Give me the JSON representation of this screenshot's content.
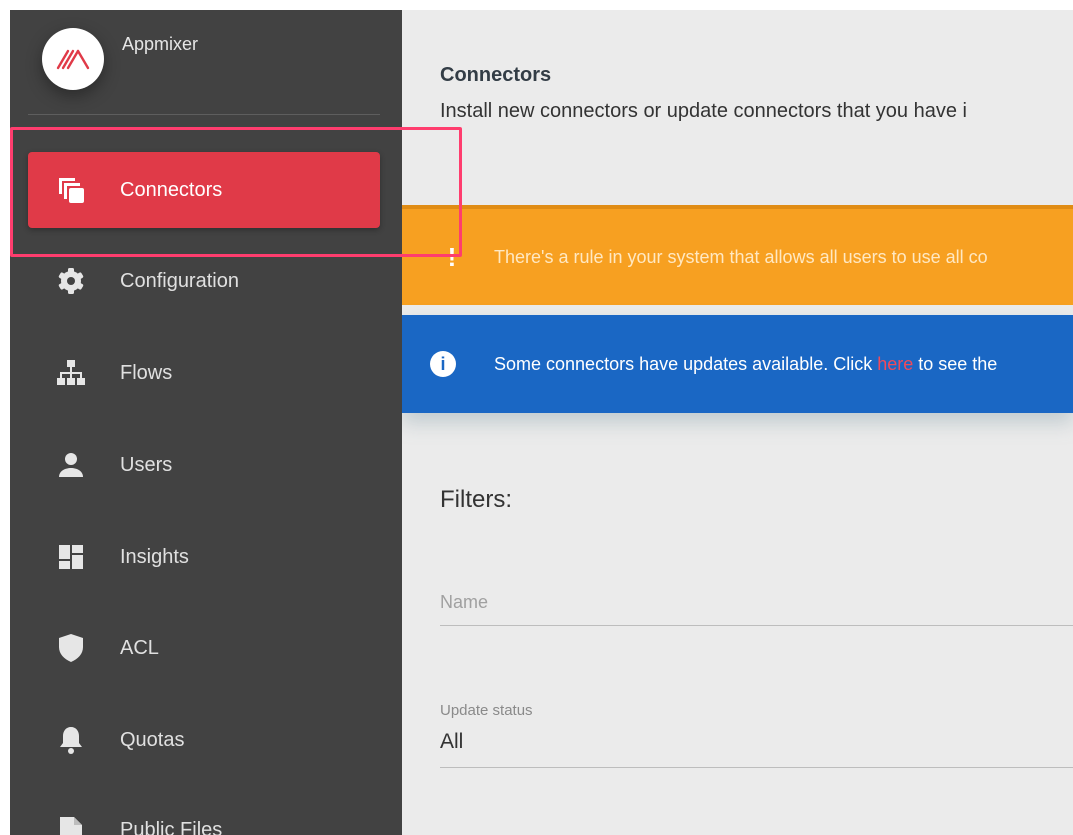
{
  "brand": {
    "name": "Appmixer"
  },
  "sidebar": {
    "items": [
      {
        "label": "Connectors",
        "icon": "connectors-icon"
      },
      {
        "label": "Configuration",
        "icon": "gear-icon"
      },
      {
        "label": "Flows",
        "icon": "sitemap-icon"
      },
      {
        "label": "Users",
        "icon": "user-icon"
      },
      {
        "label": "Insights",
        "icon": "dashboard-icon"
      },
      {
        "label": "ACL",
        "icon": "shield-icon"
      },
      {
        "label": "Quotas",
        "icon": "bell-icon"
      },
      {
        "label": "Public Files",
        "icon": "file-icon"
      }
    ],
    "active": "Connectors"
  },
  "main": {
    "title": "Connectors",
    "subtitle": "Install new connectors or update connectors that you have i",
    "warning": {
      "icon": "!",
      "text": "There's a rule in your system that allows all users to use all co"
    },
    "info": {
      "icon": "i",
      "text_before": "Some connectors have updates available. Click ",
      "link": "here",
      "text_after": " to see the"
    },
    "filters": {
      "heading": "Filters:",
      "name_placeholder": "Name",
      "status_label": "Update status",
      "status_value": "All"
    }
  },
  "colors": {
    "sidebar_bg": "#424242",
    "active_item": "#e03a48",
    "warning": "#f7a021",
    "info": "#1a67c4",
    "link": "#f04b5a",
    "highlight": "#ff3d6e"
  }
}
